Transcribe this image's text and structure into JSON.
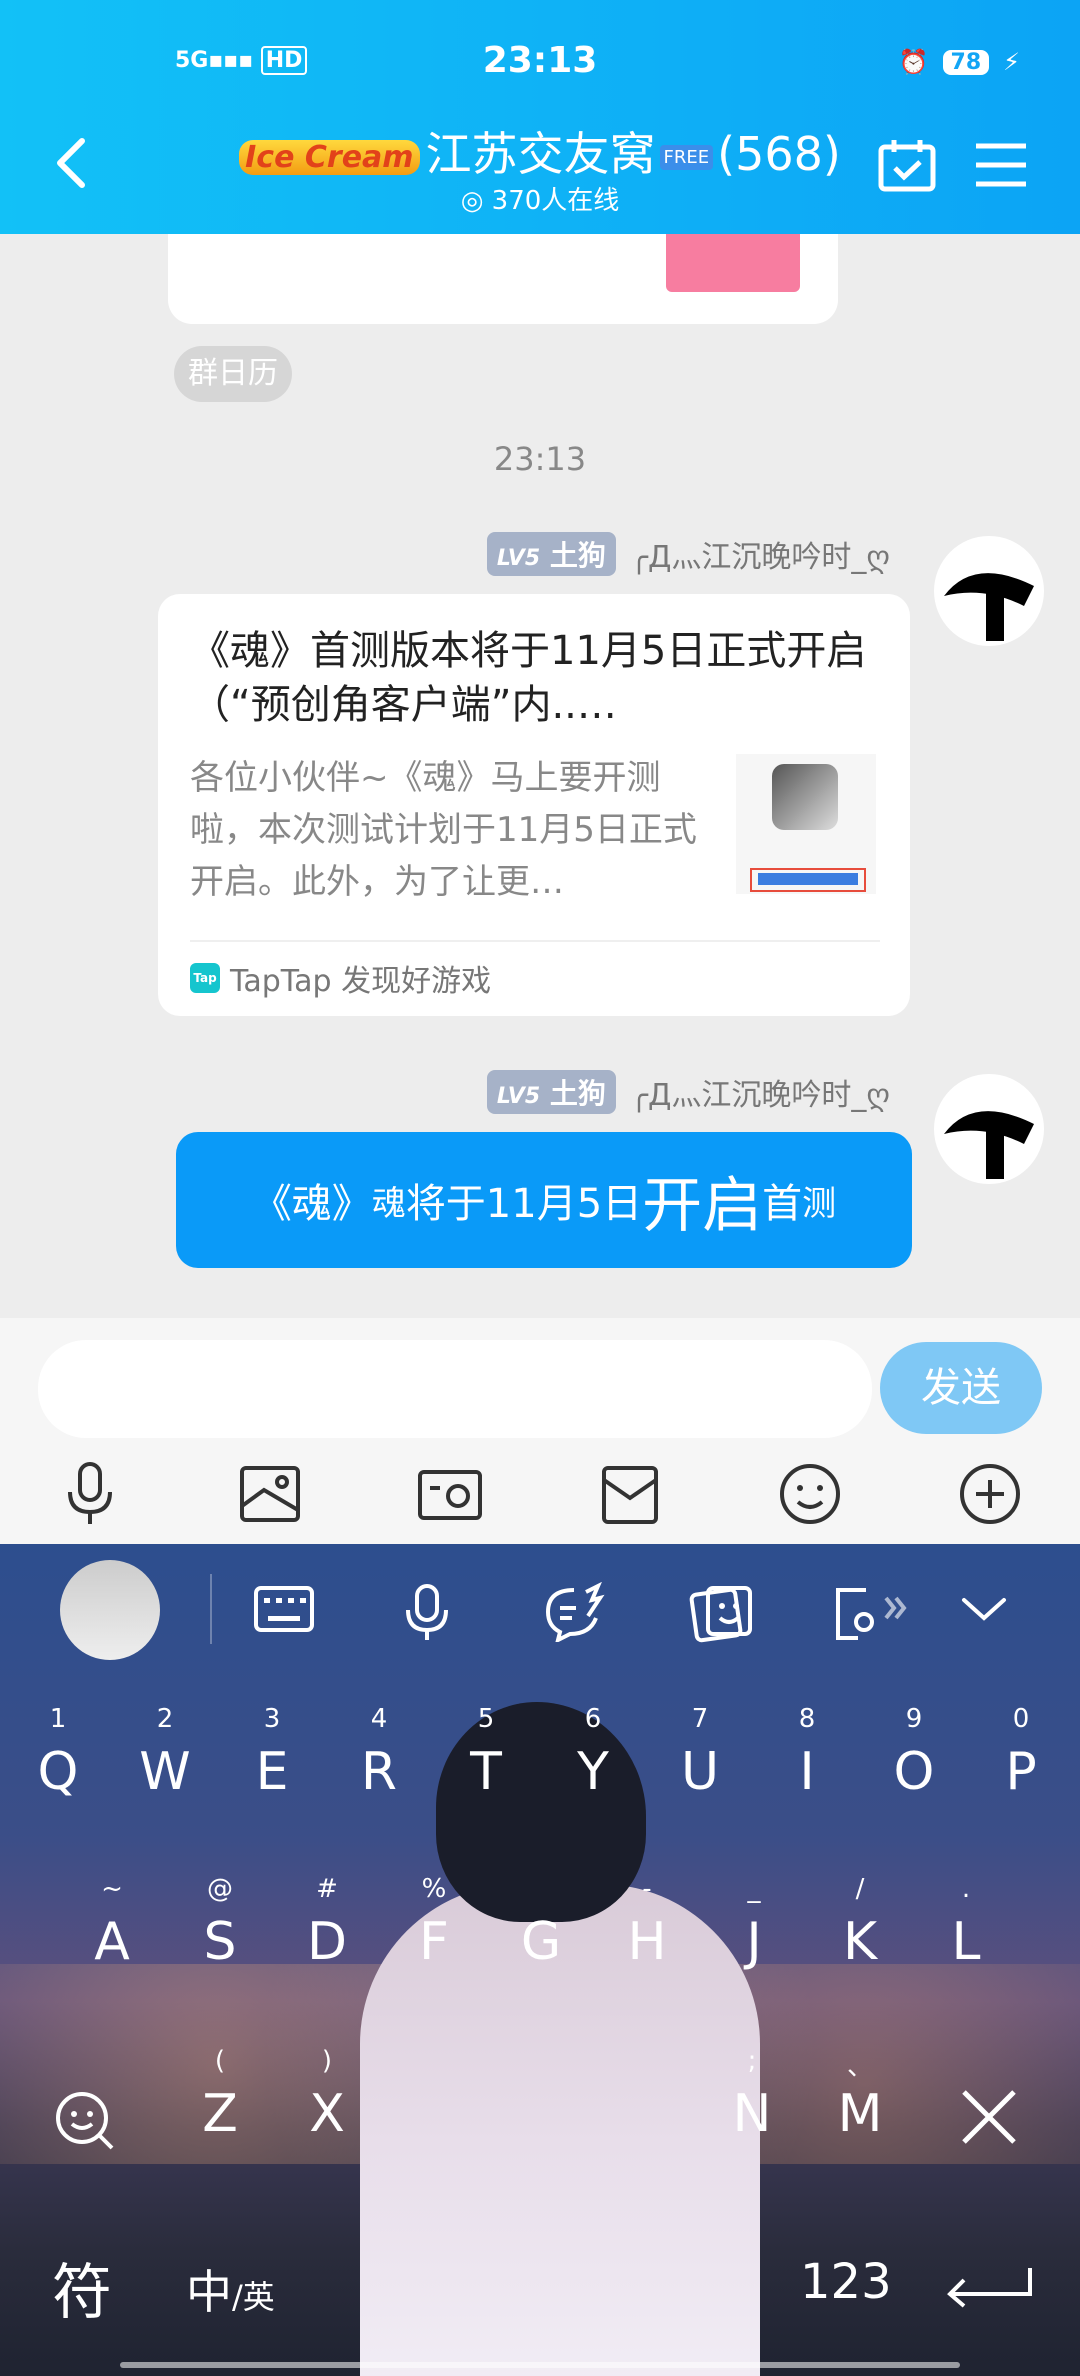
{
  "status_bar": {
    "network": "5G",
    "hd": "HD",
    "time": "23:13",
    "battery": "78"
  },
  "header": {
    "back_label": "",
    "logo_text": "Ice Cream",
    "title": "江苏交友窝",
    "free_badge": "FREE",
    "member_count": "(568)",
    "online_text": "370人在线"
  },
  "chat": {
    "calendar_pill": "群日历",
    "timestamp": "23:13",
    "messages": [
      {
        "level_badge": "LV5",
        "level_title": "土狗",
        "sender_name": "╭Д灬江沉晚吟时_ღ",
        "card": {
          "title": "《魂》首测版本将于11月5日正式开启（“预创角客户端”内..…",
          "description": "各位小伙伴~《魂》马上要开测啦，本次测试计划于11月5日正式开启。此外，为了让更…",
          "source": "TapTap 发现好游戏",
          "source_icon": "Tap"
        }
      },
      {
        "level_badge": "LV5",
        "level_title": "土狗",
        "sender_name": "╭Д灬江沉晚吟时_ღ",
        "bubble": {
          "part1": "《魂》",
          "part2": "魂",
          "part3": "将于11月5日",
          "part4": "开启",
          "part5": "首",
          "part6": "测"
        }
      }
    ]
  },
  "input_bar": {
    "placeholder": "",
    "send_label": "发送",
    "tools": [
      "mic-icon",
      "image-icon",
      "camera-icon",
      "file-icon",
      "emoji-icon",
      "plus-icon"
    ]
  },
  "keyboard": {
    "row1": [
      {
        "k": "Q",
        "s": "1"
      },
      {
        "k": "W",
        "s": "2"
      },
      {
        "k": "E",
        "s": "3"
      },
      {
        "k": "R",
        "s": "4"
      },
      {
        "k": "T",
        "s": "5"
      },
      {
        "k": "Y",
        "s": "6"
      },
      {
        "k": "U",
        "s": "7"
      },
      {
        "k": "I",
        "s": "8"
      },
      {
        "k": "O",
        "s": "9"
      },
      {
        "k": "P",
        "s": "0"
      }
    ],
    "row2": [
      {
        "k": "A",
        "s": "~"
      },
      {
        "k": "S",
        "s": "@"
      },
      {
        "k": "D",
        "s": "#"
      },
      {
        "k": "F",
        "s": "%"
      },
      {
        "k": "G",
        "s": ""
      },
      {
        "k": "H",
        "s": "-"
      },
      {
        "k": "J",
        "s": "_"
      },
      {
        "k": "K",
        "s": "/"
      },
      {
        "k": "L",
        "s": "."
      }
    ],
    "row3": [
      {
        "k": "Z",
        "s": "("
      },
      {
        "k": "X",
        "s": ")"
      },
      {
        "k": "N",
        "s": ";"
      },
      {
        "k": "M",
        "s": "、"
      }
    ],
    "symbol_key": "符",
    "lang_key_main": "中",
    "lang_key_alt": "/英",
    "num_key": "123"
  }
}
